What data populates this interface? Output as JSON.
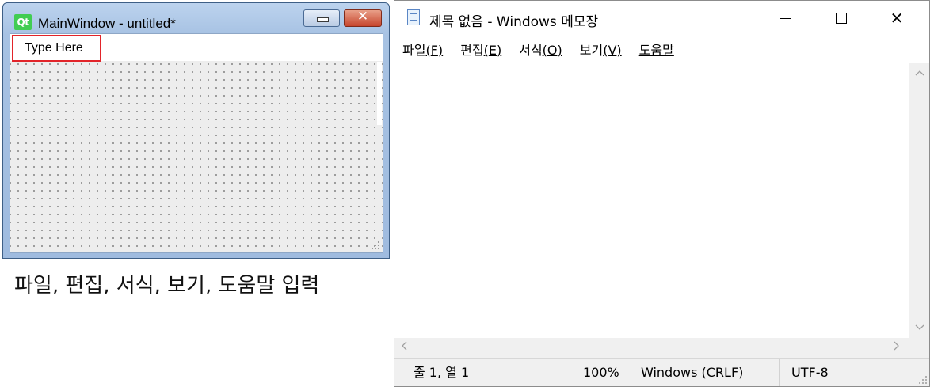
{
  "qt_window": {
    "logo_text": "Qt",
    "title": "MainWindow - untitled*",
    "minimize_icon": "minimize-icon",
    "close_icon": "close-icon",
    "close_glyph": "✕",
    "menubar_placeholder": "Type Here",
    "grid": "dotted"
  },
  "caption": "파일, 편집, 서식, 보기, 도움말 입력",
  "notepad": {
    "title": "제목 없음 - Windows 메모장",
    "controls": {
      "minimize_icon": "minimize-icon",
      "maximize_icon": "maximize-icon",
      "close_icon": "close-icon",
      "close_glyph": "✕"
    },
    "menus": [
      {
        "label": "파일",
        "key_open": "(",
        "key": "F",
        "key_close": ")"
      },
      {
        "label": "편집",
        "key_open": "(",
        "key": "E",
        "key_close": ")"
      },
      {
        "label": "서식",
        "key_open": "(",
        "key": "O",
        "key_close": ")"
      },
      {
        "label": "보기",
        "key_open": "(",
        "key": "V",
        "key_close": ")"
      },
      {
        "label": "도움말",
        "key_open": "",
        "key": "",
        "key_close": ""
      }
    ],
    "editor_text": "",
    "scroll_arrows": {
      "up": "^",
      "down": "v",
      "left": "<",
      "right": ">"
    },
    "status": {
      "position": "줄 1, 열 1",
      "zoom": "100%",
      "line_ending": "Windows (CRLF)",
      "encoding": "UTF-8"
    }
  },
  "colors": {
    "qt_frame": "#a7c2e3",
    "highlight_border": "#e2242a",
    "qt_logo": "#41cd52",
    "notepad_chrome": "#f0f0f0"
  }
}
